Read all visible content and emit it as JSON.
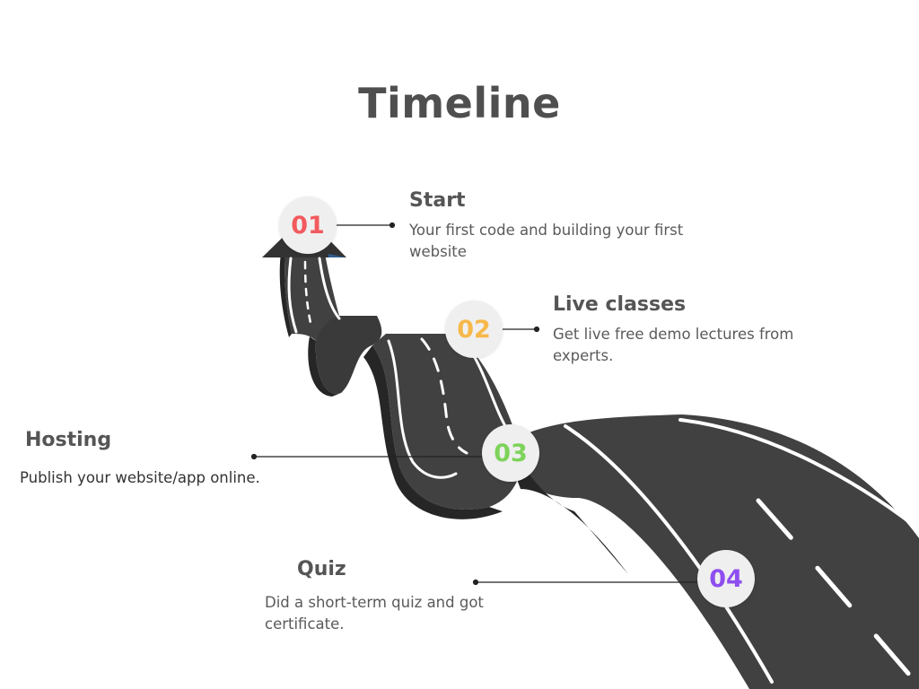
{
  "title": "Timeline",
  "milestones": [
    {
      "number": "01",
      "label": "Start",
      "description": "Your first code and  building your first website",
      "color": "#f25a5e"
    },
    {
      "number": "02",
      "label": "Live classes",
      "description": "Get live free demo lectures from experts.",
      "color": "#f7b84b"
    },
    {
      "number": "03",
      "label": "Hosting",
      "description": "Publish your website/app online.",
      "color": "#7ed35a"
    },
    {
      "number": "04",
      "label": "Quiz",
      "description": "Did a short-term quiz and got certificate.",
      "color": "#8f4ef0"
    }
  ],
  "colors": {
    "road": "#414141",
    "road_side": "#262626",
    "lane": "#ffffff",
    "connector": "#222222"
  }
}
